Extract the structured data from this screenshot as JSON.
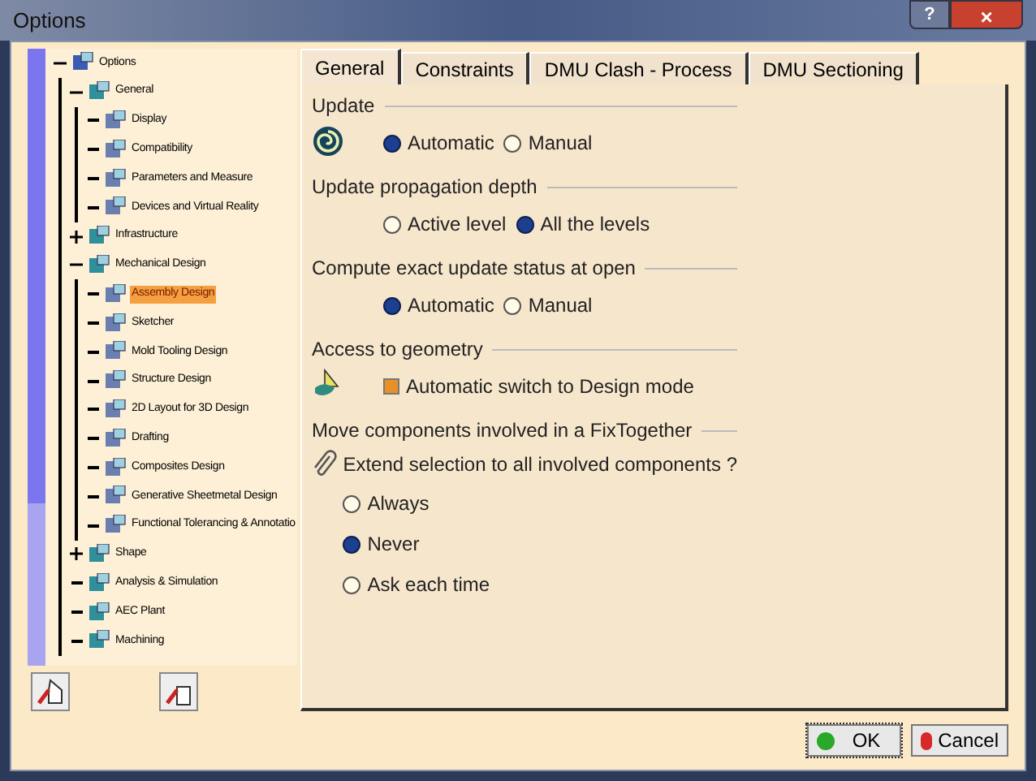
{
  "window": {
    "title": "Options",
    "help": "?",
    "close": "×"
  },
  "tree": {
    "label": "Options",
    "expanded": true,
    "selected": false,
    "children": [
      {
        "label": "General",
        "expanded": true,
        "selected": false,
        "children": [
          {
            "label": "Display",
            "selected": false
          },
          {
            "label": "Compatibility",
            "selected": false
          },
          {
            "label": "Parameters and Measure",
            "selected": false
          },
          {
            "label": "Devices and Virtual Reality",
            "selected": false
          }
        ]
      },
      {
        "label": "Infrastructure",
        "expanded": false,
        "selected": false
      },
      {
        "label": "Mechanical Design",
        "expanded": true,
        "selected": false,
        "children": [
          {
            "label": "Assembly Design",
            "selected": true
          },
          {
            "label": "Sketcher",
            "selected": false
          },
          {
            "label": "Mold Tooling Design",
            "selected": false
          },
          {
            "label": "Structure Design",
            "selected": false
          },
          {
            "label": "2D Layout for 3D Design",
            "selected": false
          },
          {
            "label": "Drafting",
            "selected": false
          },
          {
            "label": "Composites Design",
            "selected": false
          },
          {
            "label": "Generative Sheetmetal Design",
            "selected": false
          },
          {
            "label": "Functional Tolerancing & Annotatio",
            "selected": false
          }
        ]
      },
      {
        "label": "Shape",
        "expanded": false,
        "selected": false
      },
      {
        "label": "Analysis & Simulation",
        "selected": false
      },
      {
        "label": "AEC Plant",
        "selected": false
      },
      {
        "label": "Machining",
        "selected": false
      }
    ]
  },
  "tabs": [
    {
      "label": "General",
      "selected": true
    },
    {
      "label": "Constraints",
      "selected": false
    },
    {
      "label": "DMU Clash - Process",
      "selected": false
    },
    {
      "label": "DMU Sectioning",
      "selected": false
    }
  ],
  "sections": [
    {
      "title": "Update",
      "options": [
        {
          "kind": "radio",
          "label": "Automatic",
          "selected": true
        },
        {
          "kind": "radio",
          "label": "Manual",
          "selected": false
        }
      ]
    },
    {
      "title": "Update propagation depth",
      "options": [
        {
          "kind": "radio",
          "label": "Active level",
          "selected": false
        },
        {
          "kind": "radio",
          "label": "All the levels",
          "selected": true
        }
      ]
    },
    {
      "title": "Compute exact update status at open",
      "options": [
        {
          "kind": "radio",
          "label": "Automatic",
          "selected": true
        },
        {
          "kind": "radio",
          "label": "Manual",
          "selected": false
        }
      ]
    },
    {
      "title": "Access to geometry",
      "options": [
        {
          "kind": "checkbox",
          "label": "Automatic switch to Design mode",
          "checked": true
        }
      ]
    },
    {
      "title": "Move components involved in a FixTogether",
      "question": "Extend selection to all involved components ?",
      "options": [
        {
          "kind": "radio",
          "label": "Always",
          "selected": false
        },
        {
          "kind": "radio",
          "label": "Never",
          "selected": true
        },
        {
          "kind": "radio",
          "label": "Ask each time",
          "selected": false
        }
      ]
    }
  ],
  "buttons": [
    {
      "label": "OK",
      "kind": "ok"
    },
    {
      "label": "Cancel",
      "kind": "cancel"
    }
  ]
}
